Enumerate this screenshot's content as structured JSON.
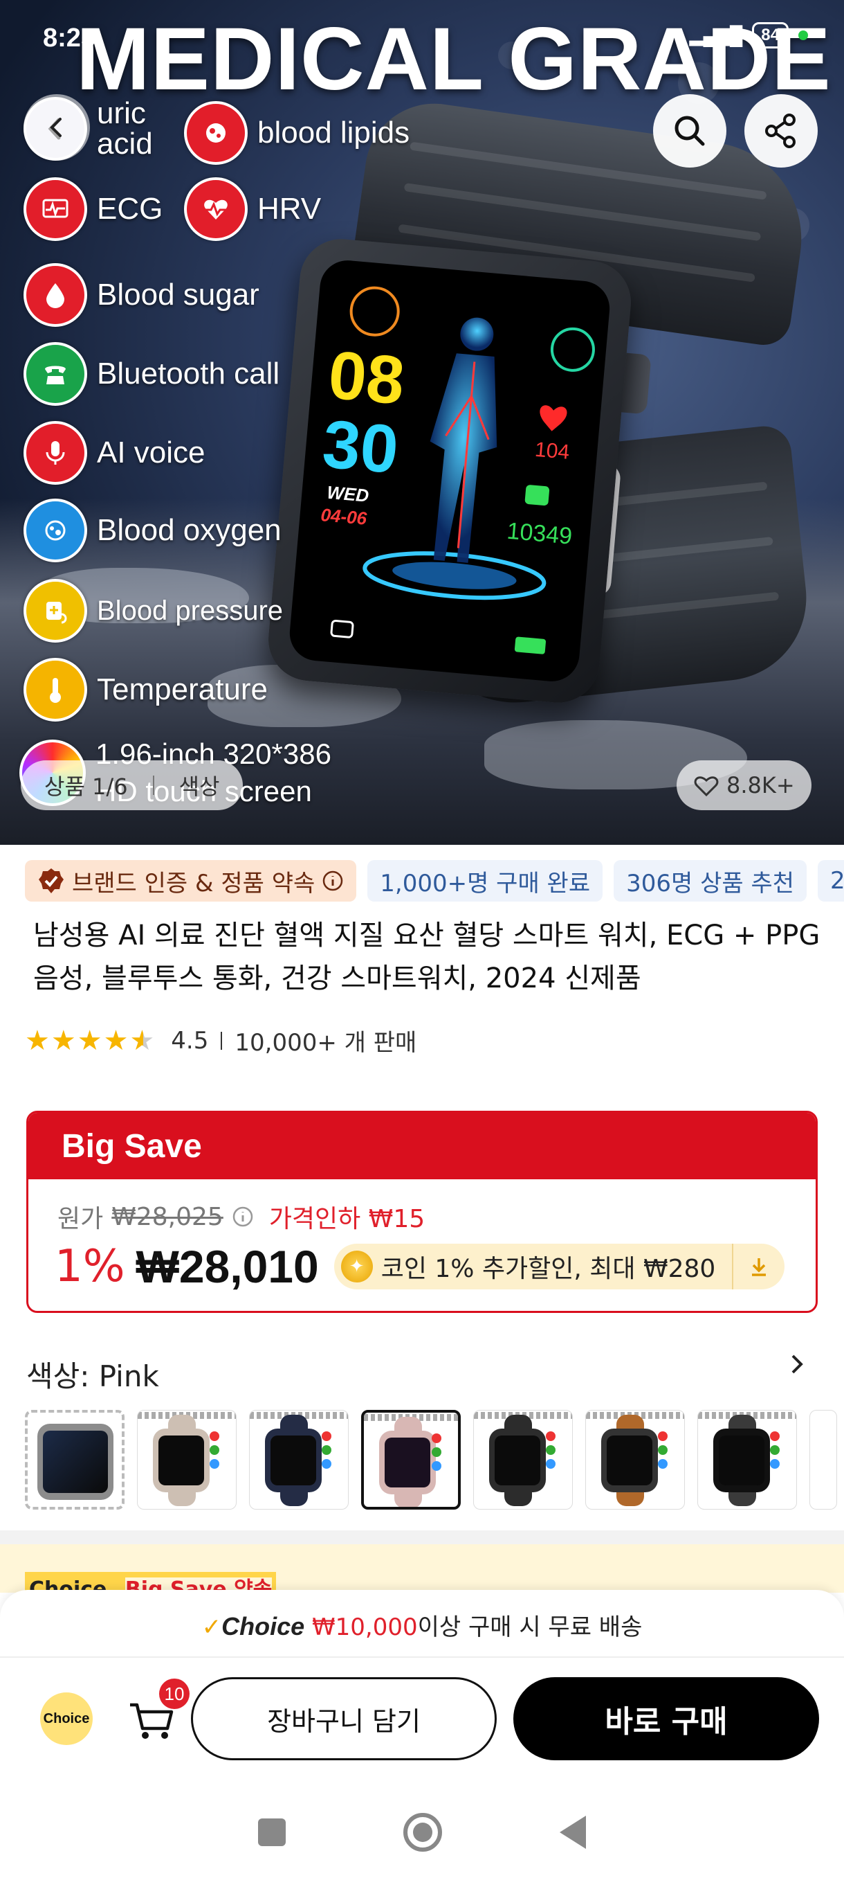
{
  "status_bar": {
    "time": "8:25",
    "battery": "84"
  },
  "hero": {
    "title": "MEDICAL GRADE",
    "features": [
      {
        "label": "uric\nacid",
        "color": "#e8e8f0",
        "icon": "uric-acid-icon"
      },
      {
        "label": "blood lipids",
        "color": "#e21e2a",
        "icon": "blood-lipids-icon"
      },
      {
        "label": "ECG",
        "color": "#e21e2a",
        "icon": "ecg-icon"
      },
      {
        "label": "HRV",
        "color": "#e21e2a",
        "icon": "hrv-icon"
      },
      {
        "label": "Blood sugar",
        "color": "#e21e2a",
        "icon": "blood-sugar-icon"
      },
      {
        "label": "Bluetooth call",
        "color": "#19a34a",
        "icon": "phone-icon"
      },
      {
        "label": "AI voice",
        "color": "#e21e2a",
        "icon": "microphone-icon"
      },
      {
        "label": "Blood oxygen",
        "color": "#1f8fe0",
        "icon": "blood-oxygen-icon"
      },
      {
        "label": "Blood pressure",
        "color": "#f0c000",
        "icon": "blood-pressure-icon"
      },
      {
        "label": "Temperature",
        "color": "#f5b400",
        "icon": "thermometer-icon"
      }
    ],
    "screen_line1": "1.96-inch 320*386",
    "screen_line2": "HD touch screen",
    "watch_face": {
      "hour": "08",
      "minute": "30",
      "day": "WED",
      "date": "04-06",
      "heart": "104",
      "steps": "10349"
    },
    "image_counter": "상품 1/6",
    "color_tab": "색상",
    "likes": "8.8K+"
  },
  "badges": {
    "brand": "브랜드 인증 & 정품 약속",
    "sold": "1,000+명 구매 완료",
    "recommend": "306명 상품 추천",
    "more": "2,"
  },
  "product": {
    "title": "남성용 AI 의료 진단 혈액 지질 요산 혈당 스마트 워치, ECG + PPG 음성, 블루투스 통화, 건강 스마트워치, 2024 신제품",
    "rating": "4.5",
    "sales": "10,000+ 개 판매"
  },
  "price": {
    "banner": "Big Save",
    "original_label": "원가",
    "original_price": "₩28,025",
    "price_drop": "가격인하 ₩15",
    "discount": "1%",
    "current_price": "₩28,010",
    "coin_text": "코인 1% 추가할인, 최대 ₩280"
  },
  "color_select": {
    "label": "색상: Pink"
  },
  "choice_strip": {
    "tag": "Choice",
    "text": "Big Save 약속"
  },
  "shipping": {
    "brand": "Choice",
    "amount": "₩10,000",
    "text": "이상 구매 시 무료 배송"
  },
  "actions": {
    "choice_circle": "Choice",
    "cart_count": "10",
    "add_to_cart": "장바구니 담기",
    "buy_now": "바로 구매"
  },
  "colors": {
    "accent_red": "#d90f1e",
    "choice_yellow": "#ffd54a",
    "coin_bg": "#fdf0cc"
  }
}
